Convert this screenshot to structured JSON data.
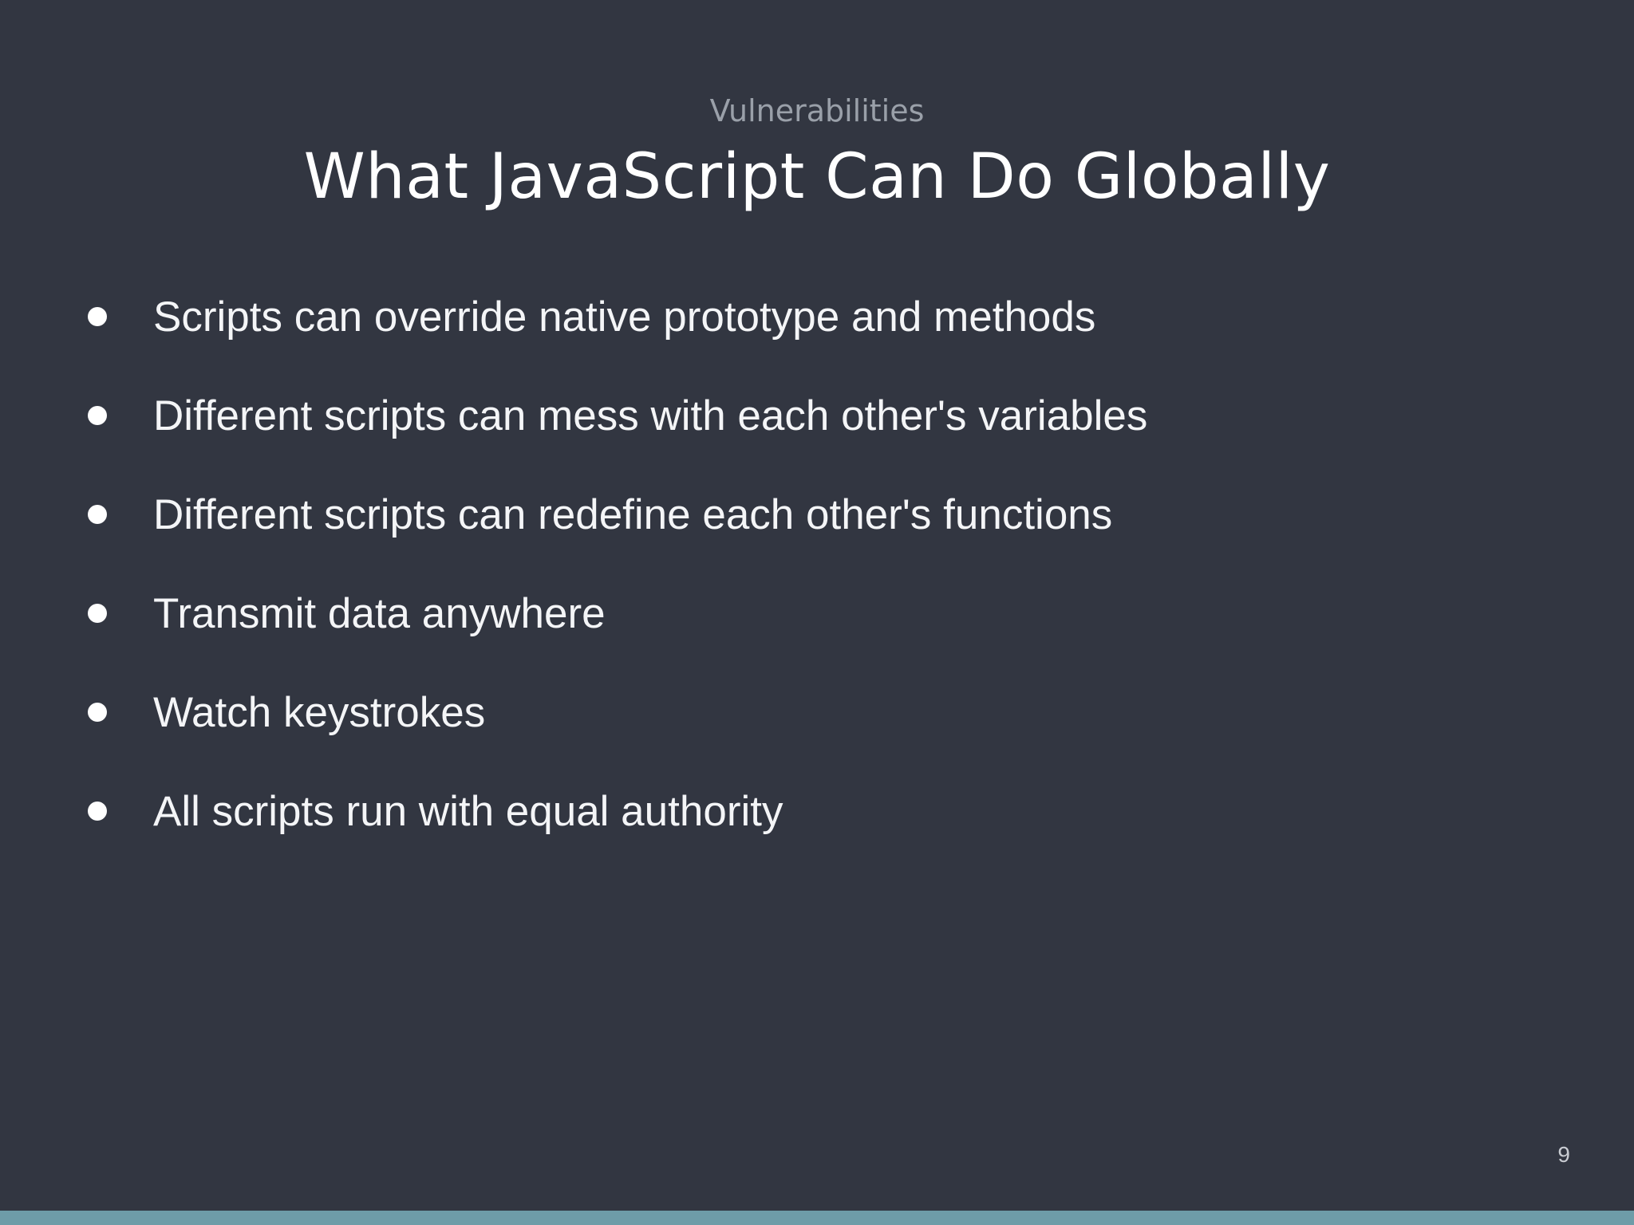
{
  "slide": {
    "kicker": "Vulnerabilities",
    "title": "What JavaScript Can Do Globally",
    "bullets": [
      "Scripts can override native prototype and methods",
      "Different scripts can mess with each other's variables",
      "Different scripts can redefine each other's functions",
      "Transmit data anywhere",
      "Watch keystrokes",
      "All scripts run with equal authority"
    ],
    "page_number": "9"
  },
  "colors": {
    "background": "#323641",
    "title": "#ffffff",
    "kicker": "#9aa0a9",
    "footer_bar": "#6e9ca8"
  }
}
